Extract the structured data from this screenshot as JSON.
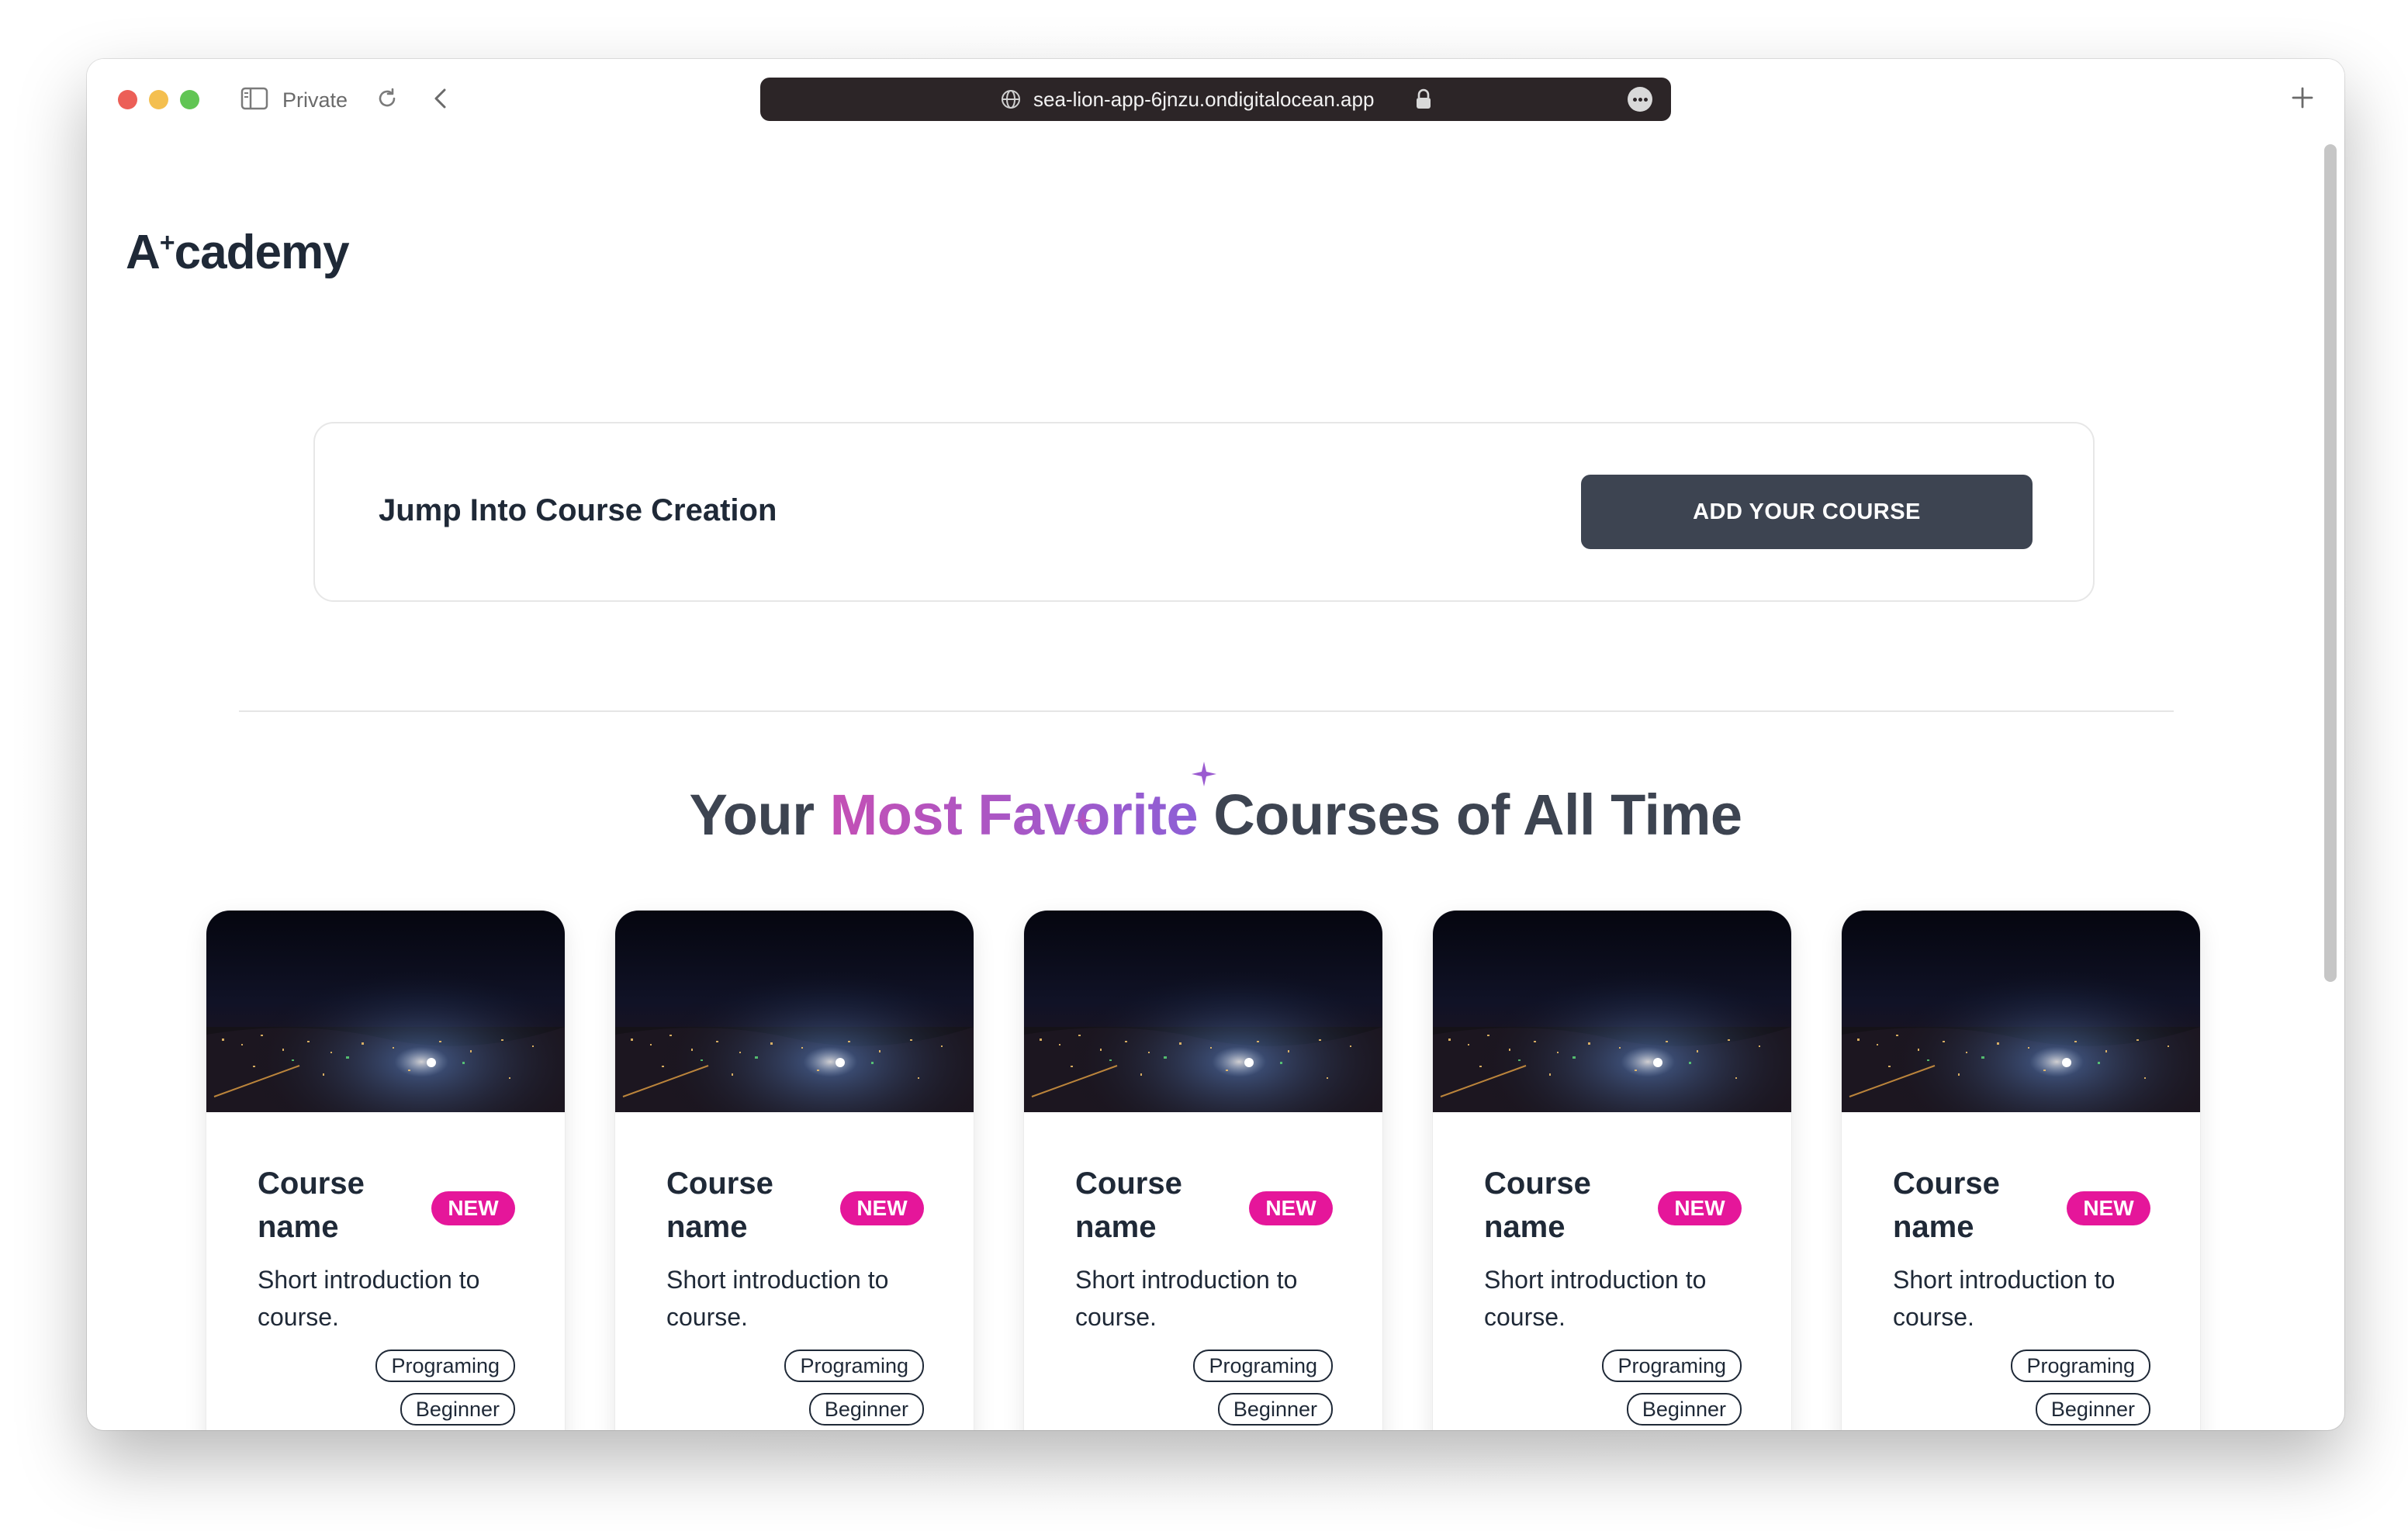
{
  "browser": {
    "private_label": "Private",
    "url": "sea-lion-app-6jnzu.ondigitalocean.app"
  },
  "logo": {
    "text_a": "A",
    "text_plus": "+",
    "text_rest": "cademy"
  },
  "cta": {
    "title": "Jump Into Course Creation",
    "button_label": "ADD YOUR COURSE"
  },
  "section": {
    "title_start": "Your ",
    "title_highlight": "Most Favorite",
    "title_end": " Courses of All Time"
  },
  "colors": {
    "accent_gradient_start": "#c44fb5",
    "accent_gradient_end": "#8d5fd6",
    "badge": "#e5169a",
    "button": "#3d4451"
  },
  "courses": [
    {
      "name": "Course name",
      "badge": "NEW",
      "description": "Short introduction to course.",
      "tags": [
        "Programing",
        "Beginner"
      ]
    },
    {
      "name": "Course name",
      "badge": "NEW",
      "description": "Short introduction to course.",
      "tags": [
        "Programing",
        "Beginner"
      ]
    },
    {
      "name": "Course name",
      "badge": "NEW",
      "description": "Short introduction to course.",
      "tags": [
        "Programing",
        "Beginner"
      ]
    },
    {
      "name": "Course name",
      "badge": "NEW",
      "description": "Short introduction to course.",
      "tags": [
        "Programing",
        "Beginner"
      ]
    },
    {
      "name": "Course name",
      "badge": "NEW",
      "description": "Short introduction to course.",
      "tags": [
        "Programing",
        "Beginner"
      ]
    }
  ]
}
